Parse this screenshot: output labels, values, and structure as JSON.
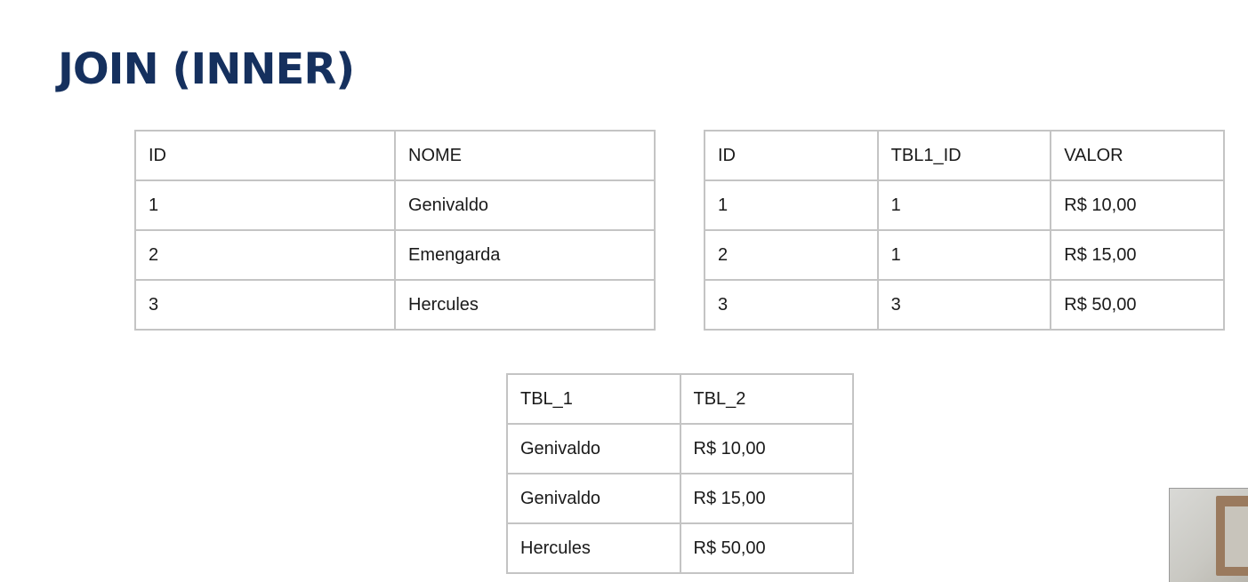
{
  "slide": {
    "title": "JOIN (INNER)"
  },
  "tables": {
    "tbl1": {
      "headers": [
        "ID",
        "NOME"
      ],
      "rows": [
        [
          "1",
          "Genivaldo"
        ],
        [
          "2",
          "Emengarda"
        ],
        [
          "3",
          "Hercules"
        ]
      ]
    },
    "tbl2": {
      "headers": [
        "ID",
        "TBL1_ID",
        "VALOR"
      ],
      "rows": [
        [
          "1",
          "1",
          "R$ 10,00"
        ],
        [
          "2",
          "1",
          "R$ 15,00"
        ],
        [
          "3",
          "3",
          "R$ 50,00"
        ]
      ]
    },
    "result": {
      "headers": [
        "TBL_1",
        "TBL_2"
      ],
      "rows": [
        [
          "Genivaldo",
          "R$ 10,00"
        ],
        [
          "Genivaldo",
          "R$ 15,00"
        ],
        [
          "Hercules",
          "R$ 50,00"
        ]
      ]
    }
  },
  "colors": {
    "title": "#15305e",
    "border": "#c4c4c4",
    "text": "#1a1a1a"
  }
}
